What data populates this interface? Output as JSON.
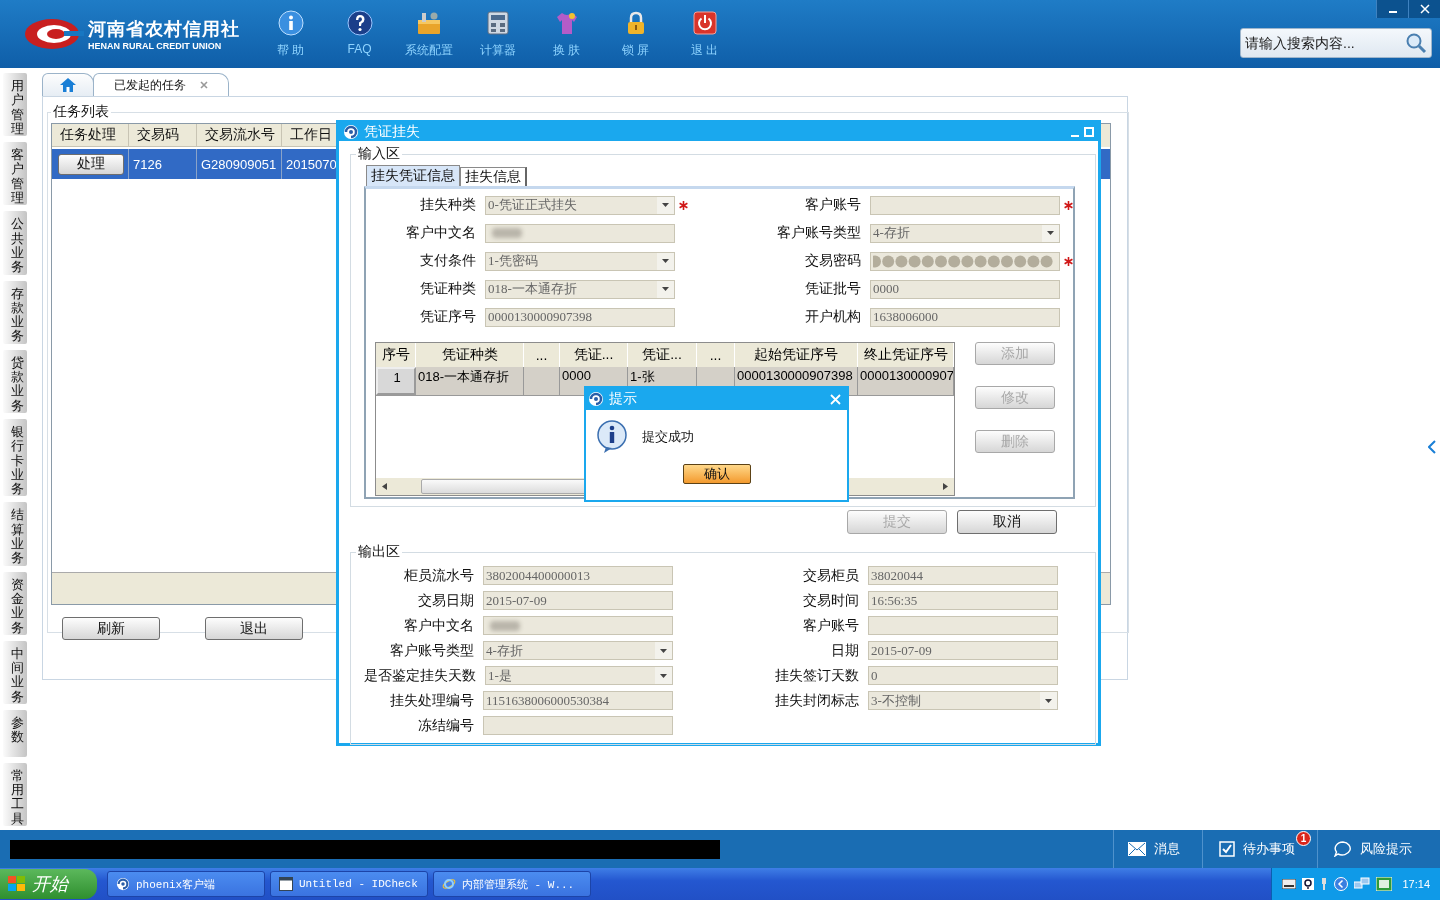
{
  "header": {
    "logo": {
      "title": "河南省农村信用社",
      "subtitle": "HENAN RURAL CREDIT UNION"
    },
    "toolbar": [
      {
        "label": "帮 助",
        "kind": "info"
      },
      {
        "label": "FAQ",
        "kind": "faq"
      },
      {
        "label": "系统配置",
        "kind": "config"
      },
      {
        "label": "计算器",
        "kind": "calculator"
      },
      {
        "label": "换 肤",
        "kind": "skin"
      },
      {
        "label": "锁 屏",
        "kind": "lock"
      },
      {
        "label": "退 出",
        "kind": "exit"
      }
    ],
    "search": {
      "placeholder": "请输入搜索内容..."
    }
  },
  "sidebar": {
    "items": [
      {
        "label": "用户管理"
      },
      {
        "label": "客户管理"
      },
      {
        "label": "公共业务"
      },
      {
        "label": "存款业务"
      },
      {
        "label": "贷款业务"
      },
      {
        "label": "银行卡业务"
      },
      {
        "label": "结算业务"
      },
      {
        "label": "资金业务"
      },
      {
        "label": "中间业务"
      },
      {
        "label": "参数"
      },
      {
        "label": "常用工具"
      }
    ]
  },
  "tabs": [
    {
      "kind": "home",
      "selected": false
    },
    {
      "kind": "page",
      "label": "已发起的任务",
      "selected": true
    }
  ],
  "task_list": {
    "title": "任务列表",
    "columns": [
      "任务处理",
      "交易码",
      "交易流水号",
      "工作日"
    ],
    "rows": [
      {
        "cells": [
          "处理",
          "7126",
          "G280909051",
          "2015070"
        ],
        "selected": true
      }
    ],
    "buttons": [
      "刷新",
      "退出"
    ]
  },
  "dialog": {
    "title": "凭证挂失",
    "input_area": {
      "title": "输入区",
      "tabs": [
        {
          "label": "挂失凭证信息",
          "selected": true
        },
        {
          "label": "挂失信息",
          "selected": false
        }
      ],
      "fields": [
        {
          "label": "挂失种类",
          "kind": "select",
          "value": "0-凭证正式挂失",
          "required": true
        },
        {
          "label": "客户账号",
          "kind": "text",
          "required": true
        },
        {
          "label": "客户中文名",
          "kind": "masked",
          "required": false
        },
        {
          "label": "客户账号类型",
          "kind": "select",
          "value": "4-存折",
          "required": false
        },
        {
          "label": "支付条件",
          "kind": "select",
          "value": "1-凭密码",
          "required": false
        },
        {
          "label": "交易密码",
          "kind": "password",
          "required": true
        },
        {
          "label": "凭证种类",
          "kind": "select",
          "value": "018-一本通存折",
          "required": false
        },
        {
          "label": "凭证批号",
          "kind": "text",
          "value": "0000",
          "required": false
        },
        {
          "label": "凭证序号",
          "kind": "text",
          "value": "0000130000907398",
          "required": false
        },
        {
          "label": "开户机构",
          "kind": "text",
          "value": "1638006000",
          "required": false
        }
      ],
      "table": {
        "columns": [
          "序号",
          "凭证种类",
          "...",
          "凭证...",
          "凭证...",
          "...",
          "起始凭证序号",
          "终止凭证序号"
        ],
        "rows": [
          [
            "1",
            "018-一本通存折",
            "",
            "0000",
            "1-张",
            "",
            "0000130000907398",
            "0000130000907"
          ]
        ]
      },
      "side_buttons": [
        {
          "label": "添加",
          "disabled": true
        },
        {
          "label": "修改",
          "disabled": true
        },
        {
          "label": "删除",
          "disabled": true
        }
      ]
    },
    "actions": [
      {
        "label": "提交",
        "disabled": true
      },
      {
        "label": "取消",
        "disabled": false
      }
    ],
    "output_area": {
      "title": "输出区",
      "fields": [
        {
          "label": "柜员流水号",
          "kind": "text",
          "value": "3802004400000013"
        },
        {
          "label": "交易柜员",
          "kind": "text",
          "value": "38020044"
        },
        {
          "label": "交易日期",
          "kind": "text",
          "value": "2015-07-09"
        },
        {
          "label": "交易时间",
          "kind": "text",
          "value": "16:56:35"
        },
        {
          "label": "客户中文名",
          "kind": "masked"
        },
        {
          "label": "客户账号",
          "kind": "text"
        },
        {
          "label": "客户账号类型",
          "kind": "select",
          "value": "4-存折"
        },
        {
          "label": "日期",
          "kind": "text",
          "value": "2015-07-09"
        },
        {
          "label": "是否鉴定挂失天数",
          "kind": "select",
          "value": "1-是"
        },
        {
          "label": "挂失签订天数",
          "kind": "text",
          "value": "0"
        },
        {
          "label": "挂失处理编号",
          "kind": "text",
          "value": "1151638006000530384"
        },
        {
          "label": "挂失封闭标志",
          "kind": "select",
          "value": "3-不控制"
        },
        {
          "label": "冻结编号",
          "kind": "text"
        }
      ]
    }
  },
  "prompt": {
    "title": "提示",
    "message": "提交成功",
    "button": "确认"
  },
  "status_bar": {
    "items": [
      {
        "label": "消息",
        "kind": "message"
      },
      {
        "label": "待办事项",
        "kind": "todo",
        "badge": "1"
      },
      {
        "label": "风险提示",
        "kind": "risk"
      }
    ]
  },
  "taskbar": {
    "start": "开始",
    "tasks": [
      {
        "label": "phoenix客户端",
        "kind": "app"
      },
      {
        "label": "Untitled - IDCheck",
        "kind": "window"
      },
      {
        "label": "内部管理系统 - W...",
        "kind": "browser"
      }
    ],
    "clock": "17:14"
  }
}
